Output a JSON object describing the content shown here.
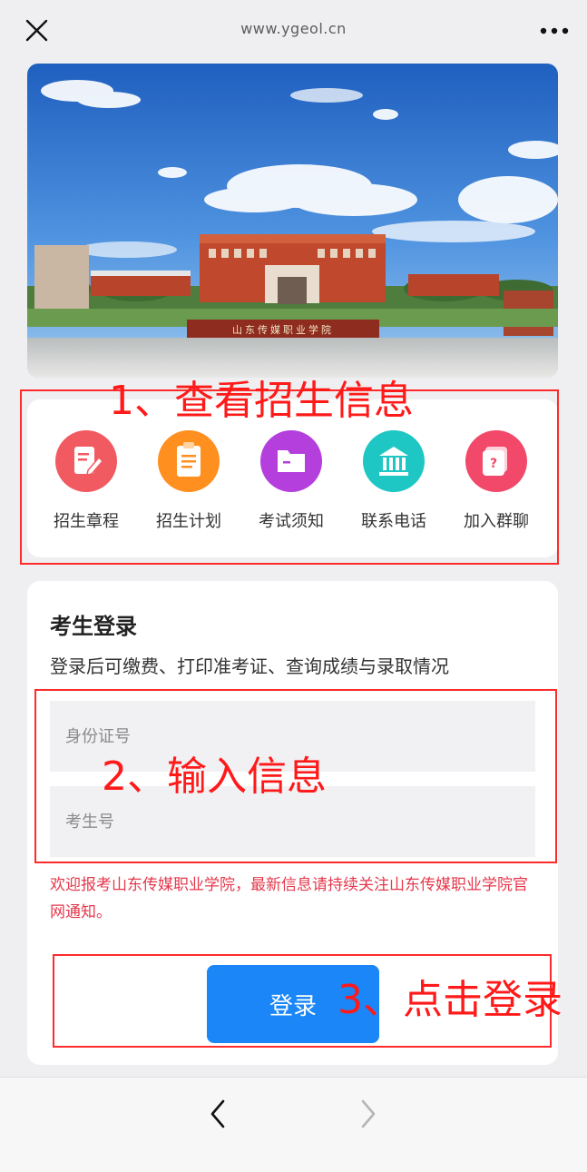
{
  "topbar": {
    "url": "www.ygeol.cn",
    "close_icon": "close-icon",
    "more_icon": "more-icon"
  },
  "banner": {
    "sign_text": "山东传媒职业学院"
  },
  "menu": {
    "items": [
      {
        "label": "招生章程",
        "icon": "document-edit-icon",
        "color": "#f25a62"
      },
      {
        "label": "招生计划",
        "icon": "clipboard-icon",
        "color": "#ff8f1f"
      },
      {
        "label": "考试须知",
        "icon": "folder-icon",
        "color": "#b43fdc"
      },
      {
        "label": "联系电话",
        "icon": "building-icon",
        "color": "#1ec7c4"
      },
      {
        "label": "加入群聊",
        "icon": "chat-question-icon",
        "color": "#f2486a"
      }
    ]
  },
  "login": {
    "title": "考生登录",
    "subtitle": "登录后可缴费、打印准考证、查询成绩与录取情况",
    "id_placeholder": "身份证号",
    "exam_placeholder": "考生号",
    "notice": "欢迎报考山东传媒职业学院，最新信息请持续关注山东传媒职业学院官网通知。",
    "button_label": "登录"
  },
  "annotations": {
    "step1": "1、查看招生信息",
    "step2": "2、输入信息",
    "step3": "3、点击登录",
    "color": "#ff1a1a"
  },
  "bottom_nav": {
    "back_icon": "chevron-left-icon",
    "forward_icon": "chevron-right-icon"
  }
}
